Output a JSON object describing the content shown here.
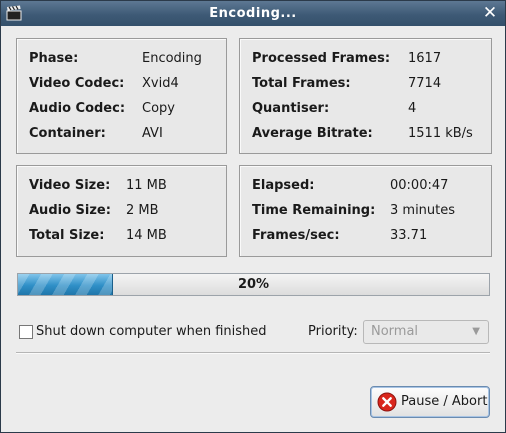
{
  "window": {
    "title": "Encoding...",
    "icons": {
      "app": "clapperboard-icon",
      "close": "close-icon"
    }
  },
  "job_panel": [
    {
      "label": "Phase:",
      "value": "Encoding"
    },
    {
      "label": "Video Codec:",
      "value": "Xvid4"
    },
    {
      "label": "Audio Codec:",
      "value": "Copy"
    },
    {
      "label": "Container:",
      "value": "AVI"
    }
  ],
  "frames_panel": [
    {
      "label": "Processed Frames:",
      "value": "1617"
    },
    {
      "label": "Total Frames:",
      "value": "7714"
    },
    {
      "label": "Quantiser:",
      "value": "4"
    },
    {
      "label": "Average Bitrate:",
      "value": "1511 kB/s"
    }
  ],
  "size_panel": [
    {
      "label": "Video Size:",
      "value": "11 MB"
    },
    {
      "label": "Audio Size:",
      "value": "2 MB"
    },
    {
      "label": "Total Size:",
      "value": "14 MB"
    }
  ],
  "time_panel": [
    {
      "label": "Elapsed:",
      "value": "00:00:47"
    },
    {
      "label": "Time Remaining:",
      "value": "3 minutes"
    },
    {
      "label": "Frames/sec:",
      "value": "33.71"
    }
  ],
  "progress": {
    "label": "20%",
    "fraction": 0.2,
    "color": "#2f8fc7"
  },
  "shutdown": {
    "label": "Shut down computer when finished",
    "checked": false
  },
  "priority": {
    "label": "Priority:",
    "selected": "Normal",
    "enabled": false
  },
  "pause_button": {
    "label": "Pause / Abort",
    "icon": "abort-icon",
    "icon_color": "#d9261c"
  }
}
